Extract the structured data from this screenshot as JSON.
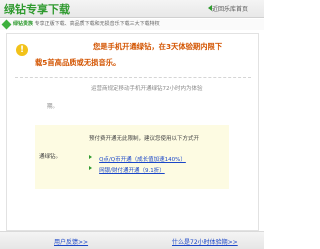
{
  "header": {
    "title": "绿钻专享下载",
    "back_label": "近回乐库首页"
  },
  "info": {
    "badge": "绿钻贵族",
    "text": "专享正版下载、高品质下载和无损音乐下载三大下载特权"
  },
  "tip": {
    "line1": "您是手机开通绿钻，在3天体验期内限下",
    "line2": "载5首高品质或无损音乐。"
  },
  "explain": {
    "line1": "运营商规定移动手机开通绿钻72小时内为体验",
    "line2": "期。"
  },
  "box": {
    "title": "预付费开通无此限制，建议您使用以下方式开",
    "desc": "通绿钻。",
    "option1": "Q点/Q币开通（成长值加速140%）",
    "option2": "网银/财付通开通（9.1折）"
  },
  "footer": {
    "left_link": "用户反馈>>",
    "right_link": "什么是72小时体验期>>"
  }
}
